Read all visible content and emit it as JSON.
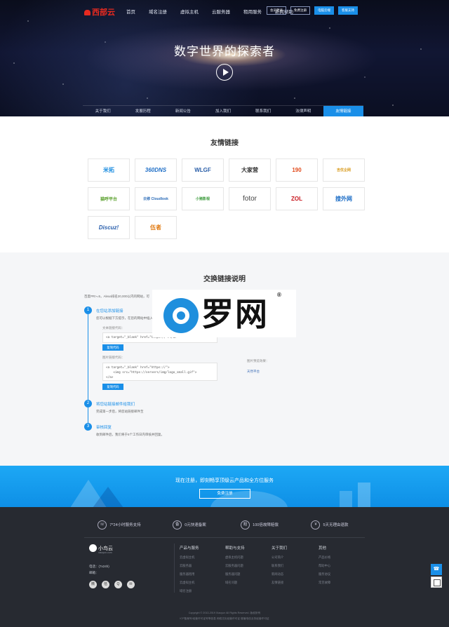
{
  "nav": {
    "logo": "西部云",
    "links": [
      "首页",
      "域名注册",
      "虚拟主机",
      "云服务器",
      "租用服务",
      "新闻帮助"
    ],
    "buttons": [
      "会员登录",
      "免费注册",
      "电脑云端",
      "客服支持"
    ]
  },
  "hero": {
    "title": "数字世界的探索者"
  },
  "subtabs": [
    "关于我们",
    "发展历程",
    "新闻公告",
    "加入我们",
    "联系我们",
    "法律声明",
    "友情链接"
  ],
  "friends": {
    "title": "友情链接",
    "logos": [
      "米拓",
      "360DNS",
      "WLGF",
      "大家营",
      "190",
      "吉优企网",
      "猫呼平台",
      "云修 Cloudlook",
      "小猪影视",
      "fotor",
      "ZOL",
      "搜外网",
      "Discuz!",
      "伍者"
    ]
  },
  "exchange": {
    "title": "交换链接说明",
    "requirement": "百度PR>=5，Alexa排名20,000以内的网站，可",
    "steps": [
      {
        "num": "1",
        "title": "在您站添加链接",
        "desc": "您可以根据下方提示，在您的网站中插入"
      },
      {
        "num": "2",
        "title": "将您站链接邮件给我们",
        "desc": "完成第一步后，将您站链接邮件至"
      },
      {
        "num": "3",
        "title": "审核回复",
        "desc": "收到邮件后，我们将于5个工作日内审核并回复。"
      }
    ],
    "text_label": "文本链接代码：",
    "text_code": "<a target=\"_blank\" href=\"https://\"></a>",
    "image_label": "图片链接代码：",
    "image_code": "<a target=\"_blank\" href=\"https://\">\n    <img src=\"https://servers/img/logo_small.gif\">\n</a>",
    "copy_button": "复制代码",
    "preview_label": "图片预览效果：",
    "preview_logo": "天然平台"
  },
  "watermark": {
    "text": "罗网",
    "reg": "®"
  },
  "banner": {
    "text": "现在注册，即刻畅享顶级云产品和全方位服务",
    "button": "免费注册"
  },
  "footer": {
    "features": [
      {
        "icon": "phone-icon",
        "glyph": "☏",
        "label": "7*24小时服务支持"
      },
      {
        "icon": "record-icon",
        "glyph": "备",
        "label": "0元快速备案"
      },
      {
        "icon": "compensation-icon",
        "glyph": "赔",
        "label": "100倍故障赔偿"
      },
      {
        "icon": "refund-icon",
        "glyph": "¥",
        "label": "5天无理由退款"
      }
    ],
    "brand": "小鸟云",
    "brand_sub": "xiaoyun.com",
    "phone": "电话：(7x24h)",
    "email": "邮箱：",
    "columns": [
      {
        "title": "产品与服务",
        "items": [
          "云虚拟主机",
          "云服务器",
          "服务器租用",
          "云虚拟主机",
          "域名注册"
        ]
      },
      {
        "title": "帮助与支持",
        "items": [
          "虚拟主机问题",
          "云服务器问题",
          "服务器问题",
          "域名问题"
        ]
      },
      {
        "title": "关于我们",
        "items": [
          "公司简介",
          "联系我们",
          "新闻动态",
          "友情链接"
        ]
      },
      {
        "title": "其他",
        "items": [
          "产品价格",
          "帮助中心",
          "服务协议",
          "常见故障"
        ]
      }
    ],
    "copyright": "Copyright © 2013-2019  Xiaoyun  All Rights Reserved. 版权所有",
    "license": "ICP备案号/经营许可证号等信息  网络文化经营许可证  增值电信业务经营许可证"
  }
}
